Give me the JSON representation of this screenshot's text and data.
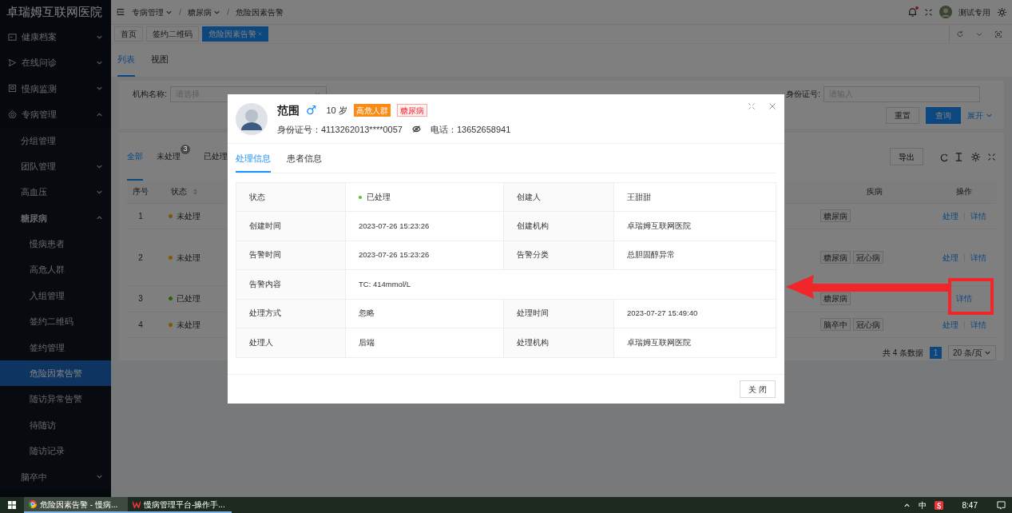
{
  "sidebar": {
    "title": "卓瑞姆互联网医院",
    "items": [
      {
        "label": "健康档案",
        "kind": "group",
        "expanded": false
      },
      {
        "label": "在线问诊",
        "kind": "group",
        "expanded": false
      },
      {
        "label": "慢病监测",
        "kind": "group",
        "expanded": false
      },
      {
        "label": "专病管理",
        "kind": "group",
        "expanded": true,
        "children": [
          {
            "label": "分组管理",
            "kind": "page",
            "selected": false
          },
          {
            "label": "团队管理",
            "kind": "group",
            "expanded": false
          },
          {
            "label": "高血压",
            "kind": "group",
            "expanded": false
          },
          {
            "label": "糖尿病",
            "kind": "group",
            "expanded": true,
            "children": [
              {
                "label": "慢病患者",
                "kind": "page",
                "selected": false
              },
              {
                "label": "高危人群",
                "kind": "page",
                "selected": false
              },
              {
                "label": "入组管理",
                "kind": "page",
                "selected": false
              },
              {
                "label": "签约二维码",
                "kind": "page",
                "selected": false
              },
              {
                "label": "签约管理",
                "kind": "page",
                "selected": false
              },
              {
                "label": "危险因素告警",
                "kind": "page",
                "selected": true
              },
              {
                "label": "随访异常告警",
                "kind": "page",
                "selected": false
              },
              {
                "label": "待随访",
                "kind": "page",
                "selected": false
              },
              {
                "label": "随访记录",
                "kind": "page",
                "selected": false
              }
            ]
          },
          {
            "label": "脑卒中",
            "kind": "group",
            "expanded": false
          }
        ]
      }
    ]
  },
  "breadcrumb_separator": "/",
  "breadcrumb": [
    {
      "label": "专病管理",
      "dropdown": true
    },
    {
      "label": "糖尿病",
      "dropdown": true
    },
    {
      "label": "危险因素告警",
      "dropdown": false
    }
  ],
  "user": {
    "name": "测试专用",
    "has_notification": true
  },
  "page_tabs": [
    {
      "label": "首页",
      "selected": false,
      "closable": false
    },
    {
      "label": "签约二维码",
      "selected": false,
      "closable": false
    },
    {
      "label": "危险因素告警",
      "selected": true,
      "closable": true
    }
  ],
  "view_tabs": [
    {
      "label": "列表",
      "selected": true
    },
    {
      "label": "视图",
      "selected": false
    }
  ],
  "filters": [
    {
      "label": "机构名称:",
      "placeholder": "请选择",
      "kind": "select"
    },
    {
      "label": "身份证号:",
      "placeholder": "请输入",
      "kind": "input"
    }
  ],
  "filter_buttons": {
    "reset": "重置",
    "search": "查询",
    "expand": "展开"
  },
  "status_tabs": [
    {
      "label": "全部",
      "selected": true
    },
    {
      "label": "未处理",
      "selected": false,
      "badge": "3"
    },
    {
      "label": "已处理",
      "selected": false
    }
  ],
  "export_button": "导出",
  "table": {
    "columns": [
      "序号",
      "状态",
      "疾病",
      "操作"
    ],
    "rows": [
      {
        "index": "1",
        "status": "未处理",
        "color": "#7d570a",
        "diseases": [
          "糖尿病"
        ],
        "actions": [
          "处理",
          "详情"
        ],
        "tall": false
      },
      {
        "index": "2",
        "status": "未处理",
        "color": "#7d570a",
        "diseases": [
          "糖尿病",
          "冠心病"
        ],
        "actions": [
          "处理",
          "详情"
        ],
        "tall": true
      },
      {
        "index": "3",
        "status": "已处理",
        "color": "#29620d",
        "diseases": [
          "糖尿病"
        ],
        "actions": [
          "详情"
        ],
        "tall": false
      },
      {
        "index": "4",
        "status": "未处理",
        "color": "#7d570a",
        "diseases": [
          "脑卒中",
          "冠心病"
        ],
        "actions": [
          "处理",
          "详情"
        ],
        "tall": false
      }
    ]
  },
  "pagination": {
    "total": "共 4 条数据",
    "pages": [
      {
        "label": "1",
        "selected": true
      }
    ],
    "page_size": "20 条/页"
  },
  "dialog": {
    "name": "范围",
    "gender": "♂",
    "age": "10 岁",
    "tags": [
      {
        "label": "高危人群",
        "kind": "solid"
      },
      {
        "label": "糖尿病",
        "kind": "outline"
      }
    ],
    "id_number": "身份证号：4113262013****0057",
    "phone": "电话：13652658941",
    "tabs": [
      {
        "label": "处理信息",
        "selected": true
      },
      {
        "label": "患者信息",
        "selected": false
      }
    ],
    "details": [
      [
        {
          "label": "状态",
          "value": "已处理",
          "color": "#52c41a"
        },
        {
          "label": "创建人",
          "value": "王甜甜"
        }
      ],
      [
        {
          "label": "创建时间",
          "value": "2023-07-26 15:23:26"
        },
        {
          "label": "创建机构",
          "value": "卓瑞姆互联网医院"
        }
      ],
      [
        {
          "label": "告警时间",
          "value": "2023-07-26 15:23:26"
        },
        {
          "label": "告警分类",
          "value": "总胆固醇异常"
        }
      ],
      [
        {
          "label": "告警内容",
          "value": "TC: 414mmol/L"
        }
      ],
      [
        {
          "label": "处理方式",
          "value": "忽略"
        },
        {
          "label": "处理时间",
          "value": "2023-07-27 15:49:40"
        }
      ],
      [
        {
          "label": "处理人",
          "value": "后端"
        },
        {
          "label": "处理机构",
          "value": "卓瑞姆互联网医院"
        }
      ]
    ],
    "close_button": "关 闭"
  },
  "taskbar": {
    "apps": [
      {
        "label": "危险因素告警 - 慢病...",
        "selected": true
      },
      {
        "label": "慢病管理平台-操作手...",
        "selected": false
      }
    ],
    "ime": "中",
    "time": "8:47"
  }
}
